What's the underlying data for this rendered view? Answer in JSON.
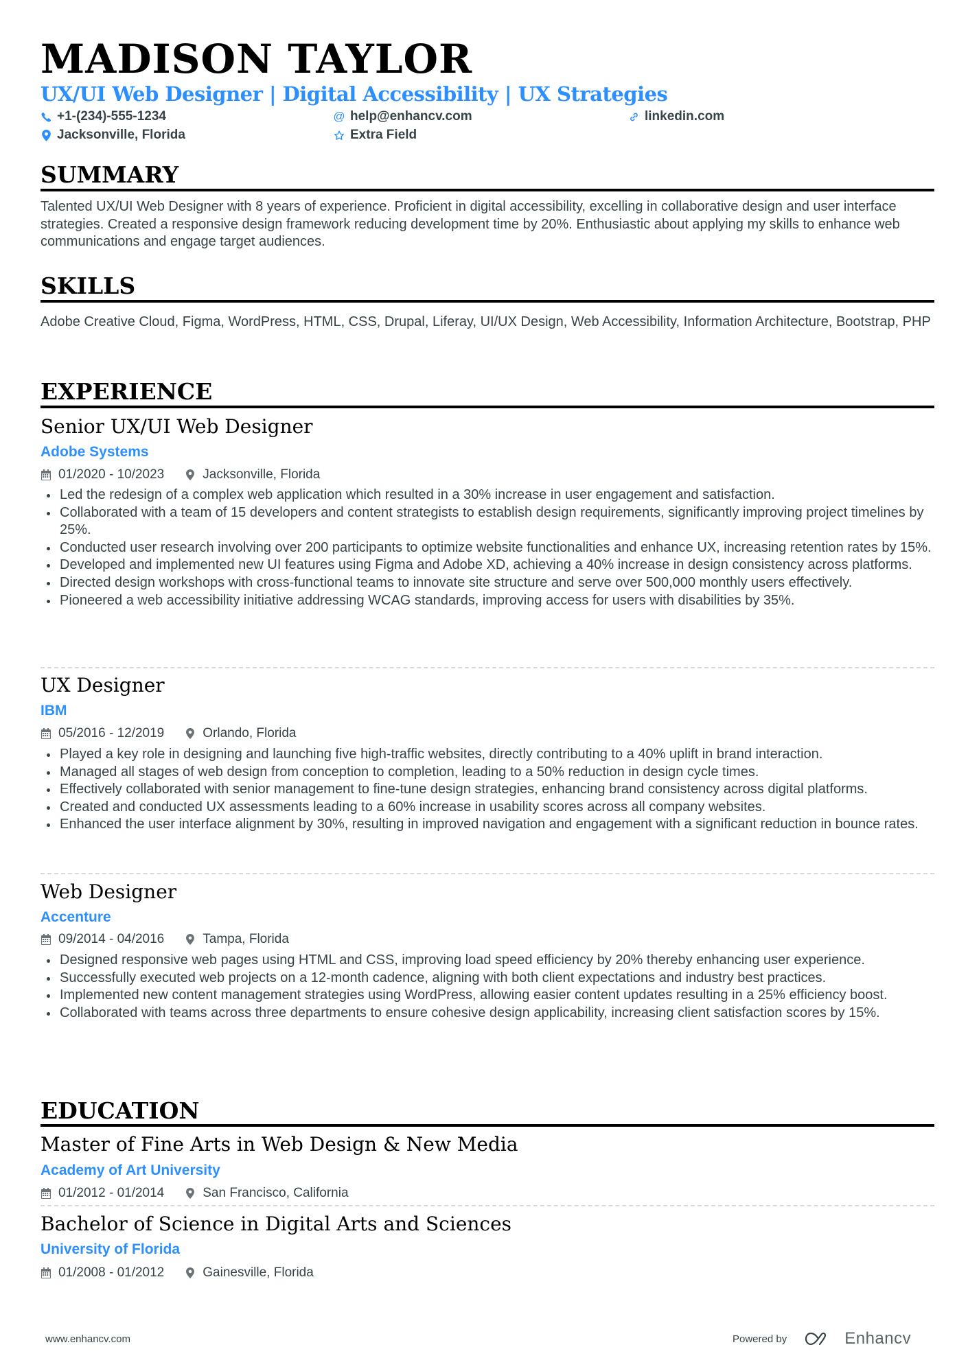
{
  "header": {
    "name": "MADISON TAYLOR",
    "headline": "UX/UI Web Designer | Digital Accessibility | UX Strategies",
    "contacts": [
      {
        "icon": "phone-icon",
        "value": "+1-(234)-555-1234"
      },
      {
        "icon": "at-icon",
        "value": "help@enhancv.com"
      },
      {
        "icon": "link-icon",
        "value": "linkedin.com"
      },
      {
        "icon": "location-icon",
        "value": "Jacksonville, Florida"
      },
      {
        "icon": "star-icon",
        "value": "Extra Field"
      }
    ]
  },
  "colors": {
    "accent": "#2d8ffb",
    "text": "#384347",
    "heading": "#000000"
  },
  "summary": {
    "title": "SUMMARY",
    "text": "Talented UX/UI Web Designer with 8 years of experience. Proficient in digital accessibility, excelling in collaborative design and user interface strategies. Created a responsive design framework reducing development time by 20%. Enthusiastic about applying my skills to enhance web communications and engage target audiences."
  },
  "skills": {
    "title": "SKILLS",
    "text": "Adobe Creative Cloud, Figma, WordPress, HTML, CSS, Drupal, Liferay, UI/UX Design, Web Accessibility, Information Architecture, Bootstrap, PHP"
  },
  "experience": {
    "title": "EXPERIENCE",
    "jobs": [
      {
        "title": "Senior UX/UI Web Designer",
        "company": "Adobe Systems",
        "dates": "01/2020 - 10/2023",
        "location": "Jacksonville, Florida",
        "bullets": [
          "Led the redesign of a complex web application which resulted in a 30% increase in user engagement and satisfaction.",
          "Collaborated with a team of 15 developers and content strategists to establish design requirements, significantly improving project timelines by 25%.",
          "Conducted user research involving over 200 participants to optimize website functionalities and enhance UX, increasing retention rates by 15%.",
          "Developed and implemented new UI features using Figma and Adobe XD, achieving a 40% increase in design consistency across platforms.",
          "Directed design workshops with cross-functional teams to innovate site structure and serve over 500,000 monthly users effectively.",
          "Pioneered a web accessibility initiative addressing WCAG standards, improving access for users with disabilities by 35%."
        ]
      },
      {
        "title": "UX Designer",
        "company": "IBM",
        "dates": "05/2016 - 12/2019",
        "location": "Orlando, Florida",
        "bullets": [
          "Played a key role in designing and launching five high-traffic websites, directly contributing to a 40% uplift in brand interaction.",
          "Managed all stages of web design from conception to completion, leading to a 50% reduction in design cycle times.",
          "Effectively collaborated with senior management to fine-tune design strategies, enhancing brand consistency across digital platforms.",
          "Created and conducted UX assessments leading to a 60% increase in usability scores across all company websites.",
          "Enhanced the user interface alignment by 30%, resulting in improved navigation and engagement with a significant reduction in bounce rates."
        ]
      },
      {
        "title": "Web Designer",
        "company": "Accenture",
        "dates": "09/2014 - 04/2016",
        "location": "Tampa, Florida",
        "bullets": [
          "Designed responsive web pages using HTML and CSS, improving load speed efficiency by 20% thereby enhancing user experience.",
          "Successfully executed web projects on a 12-month cadence, aligning with both client expectations and industry best practices.",
          "Implemented new content management strategies using WordPress, allowing easier content updates resulting in a 25% efficiency boost.",
          "Collaborated with teams across three departments to ensure cohesive design applicability, increasing client satisfaction scores by 15%."
        ]
      }
    ]
  },
  "education": {
    "title": "EDUCATION",
    "items": [
      {
        "degree": "Master of Fine Arts in Web Design & New Media",
        "school": "Academy of Art University",
        "dates": "01/2012 - 01/2014",
        "location": "San Francisco, California"
      },
      {
        "degree": "Bachelor of Science in Digital Arts and Sciences",
        "school": "University of Florida",
        "dates": "01/2008 - 01/2012",
        "location": "Gainesville, Florida"
      }
    ]
  },
  "footer": {
    "website": "www.enhancv.com",
    "powered_by": "Powered by",
    "brand": "Enhancv"
  }
}
